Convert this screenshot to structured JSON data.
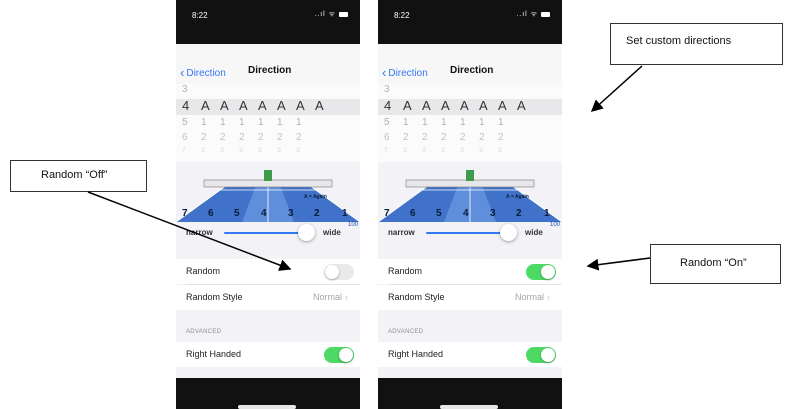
{
  "phones": [
    {
      "id": "left",
      "time": "8:22",
      "status_icons": "..ıl ᯤ",
      "nav": {
        "back_label": "Direction",
        "title": "Direction"
      },
      "picker": {
        "row_prev": [
          "3"
        ],
        "row_selected": [
          "4",
          "A",
          "A",
          "A",
          "A",
          "A",
          "A",
          "A"
        ],
        "row_next1": [
          "5",
          "1",
          "1",
          "1",
          "1",
          "1",
          "1"
        ],
        "row_next2": [
          "6",
          "2",
          "2",
          "2",
          "2",
          "2",
          "2"
        ],
        "row_next3": [
          "7",
          "3",
          "3",
          "3",
          "3",
          "3",
          "3"
        ]
      },
      "court": {
        "zones": [
          "7",
          "6",
          "5",
          "4",
          "3",
          "2",
          "1"
        ],
        "legend": "A = Again"
      },
      "slider": {
        "min_label": "narrow",
        "max_label": "wide",
        "max_value": "100",
        "value": 100
      },
      "settings": {
        "random_label": "Random",
        "random_on": false,
        "random_style_label": "Random Style",
        "random_style_value": "Normal",
        "section_header": "ADVANCED",
        "right_handed_label": "Right Handed",
        "right_handed_on": true
      }
    },
    {
      "id": "right",
      "time": "8:22",
      "status_icons": "..ıl ᯤ",
      "nav": {
        "back_label": "Direction",
        "title": "Direction"
      },
      "picker": {
        "row_prev": [
          "3"
        ],
        "row_selected": [
          "4",
          "A",
          "A",
          "A",
          "A",
          "A",
          "A",
          "A"
        ],
        "row_next1": [
          "5",
          "1",
          "1",
          "1",
          "1",
          "1",
          "1"
        ],
        "row_next2": [
          "6",
          "2",
          "2",
          "2",
          "2",
          "2",
          "2"
        ],
        "row_next3": [
          "7",
          "3",
          "3",
          "3",
          "3",
          "3",
          "3"
        ]
      },
      "court": {
        "zones": [
          "7",
          "6",
          "5",
          "4",
          "3",
          "2",
          "1"
        ],
        "legend": "A = Again"
      },
      "slider": {
        "min_label": "narrow",
        "max_label": "wide",
        "max_value": "100",
        "value": 100
      },
      "settings": {
        "random_label": "Random",
        "random_on": true,
        "random_style_label": "Random Style",
        "random_style_value": "Normal",
        "section_header": "ADVANCED",
        "right_handed_label": "Right Handed",
        "right_handed_on": true
      }
    }
  ],
  "callouts": {
    "custom_directions": "Set custom directions",
    "random_off": "Random “Off”",
    "random_on": "Random “On”"
  },
  "colors": {
    "accent_blue": "#3478f6",
    "toggle_green": "#4cd964",
    "court_blue": "#3f72c8",
    "status_bar": "#111111"
  },
  "icons": {
    "back": "chevron-left-icon",
    "disclosure": "chevron-right-icon",
    "status": [
      "signal-icon",
      "wifi-icon",
      "battery-icon"
    ]
  }
}
